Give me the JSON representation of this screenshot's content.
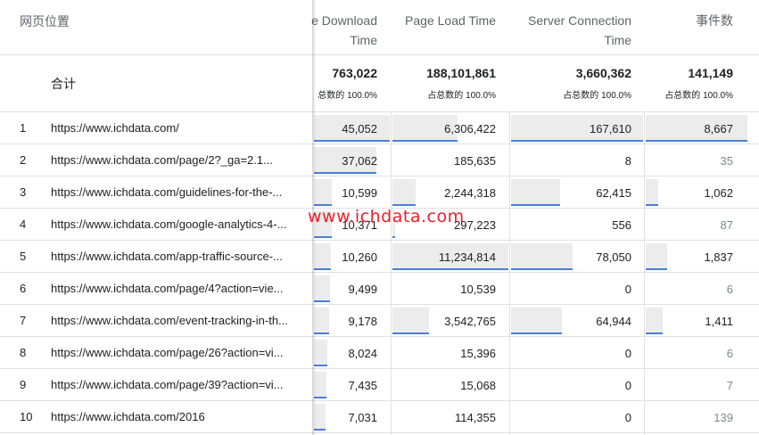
{
  "header": {
    "page_location": "网页位置",
    "col1": [
      "e Download",
      "Time"
    ],
    "col2": [
      "Page Load Time",
      ""
    ],
    "col3": [
      "Server Connection",
      "Time"
    ],
    "col4": [
      "事件数",
      ""
    ]
  },
  "totals": {
    "label": "合计",
    "values": [
      "763,022",
      "188,101,861",
      "3,660,362",
      "141,149"
    ],
    "pcts": [
      "总数的 100.0%",
      "占总数的 100.0%",
      "占总数的 100.0%",
      "占总数的 100.0%"
    ]
  },
  "rows": [
    {
      "n": "1",
      "url": "https://www.ichdata.com/",
      "c1": "45,052",
      "c2": "6,306,422",
      "c3": "167,610",
      "c4": "8,667"
    },
    {
      "n": "2",
      "url": "https://www.ichdata.com/page/2?_ga=2.1...",
      "c1": "37,062",
      "c2": "185,635",
      "c3": "8",
      "c4": "35"
    },
    {
      "n": "3",
      "url": "https://www.ichdata.com/guidelines-for-the-...",
      "c1": "10,599",
      "c2": "2,244,318",
      "c3": "62,415",
      "c4": "1,062"
    },
    {
      "n": "4",
      "url": "https://www.ichdata.com/google-analytics-4-...",
      "c1": "10,371",
      "c2": "297,223",
      "c3": "556",
      "c4": "87"
    },
    {
      "n": "5",
      "url": "https://www.ichdata.com/app-traffic-source-...",
      "c1": "10,260",
      "c2": "11,234,814",
      "c3": "78,050",
      "c4": "1,837"
    },
    {
      "n": "6",
      "url": "https://www.ichdata.com/page/4?action=vie...",
      "c1": "9,499",
      "c2": "10,539",
      "c3": "0",
      "c4": "6"
    },
    {
      "n": "7",
      "url": "https://www.ichdata.com/event-tracking-in-th...",
      "c1": "9,178",
      "c2": "3,542,765",
      "c3": "64,944",
      "c4": "1,411"
    },
    {
      "n": "8",
      "url": "https://www.ichdata.com/page/26?action=vi...",
      "c1": "8,024",
      "c2": "15,396",
      "c3": "0",
      "c4": "6"
    },
    {
      "n": "9",
      "url": "https://www.ichdata.com/page/39?action=vi...",
      "c1": "7,435",
      "c2": "15,068",
      "c3": "0",
      "c4": "7"
    },
    {
      "n": "10",
      "url": "https://www.ichdata.com/2016",
      "c1": "7,031",
      "c2": "114,355",
      "c3": "0",
      "c4": "139"
    }
  ],
  "watermark": "www.ichdata.com",
  "colors": {
    "bar_fill": "#ececed",
    "bar_line": "#4a7fd6",
    "watermark": "#e8202a"
  }
}
